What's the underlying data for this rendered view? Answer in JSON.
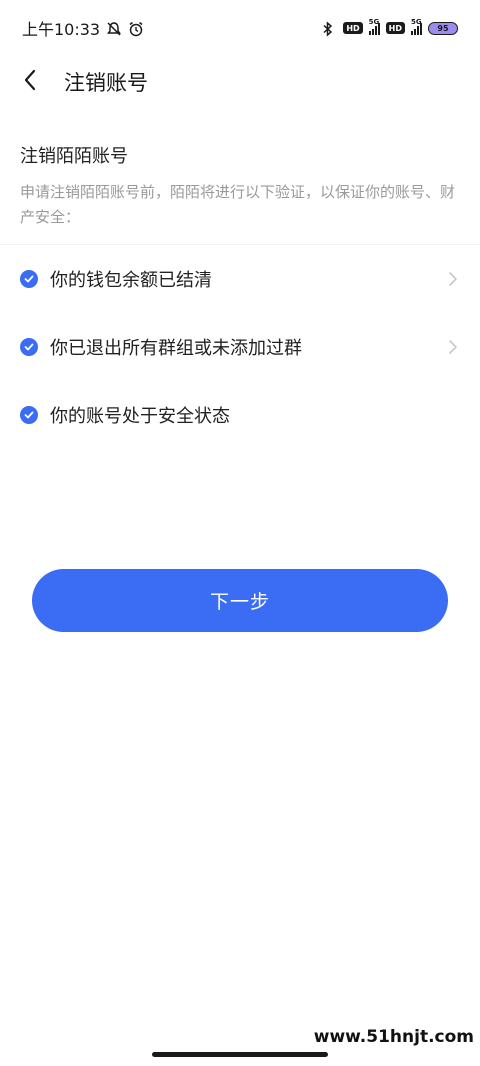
{
  "status_bar": {
    "time": "上午10:33",
    "battery": "95",
    "network_1": "5G",
    "network_2": "5G",
    "hd_1": "HD",
    "hd_2": "HD",
    "icons": [
      "mute-icon",
      "alarm-icon",
      "bluetooth-icon",
      "hd-icon",
      "signal-icon",
      "battery-icon"
    ]
  },
  "header": {
    "title": "注销账号",
    "back_icon": "chevron-left-icon"
  },
  "intro": {
    "title": "注销陌陌账号",
    "description": "申请注销陌陌账号前，陌陌将进行以下验证，以保证你的账号、财产安全："
  },
  "checks": [
    {
      "label": "你的钱包余额已结清",
      "has_arrow": true
    },
    {
      "label": "你已退出所有群组或未添加过群",
      "has_arrow": true
    },
    {
      "label": "你的账号处于安全状态",
      "has_arrow": false
    }
  ],
  "next_button": {
    "label": "下一步"
  },
  "watermark": "www.51hnjt.com",
  "colors": {
    "accent": "#3a6cf4",
    "text_primary": "#222222",
    "text_secondary": "#9a9a9a"
  }
}
